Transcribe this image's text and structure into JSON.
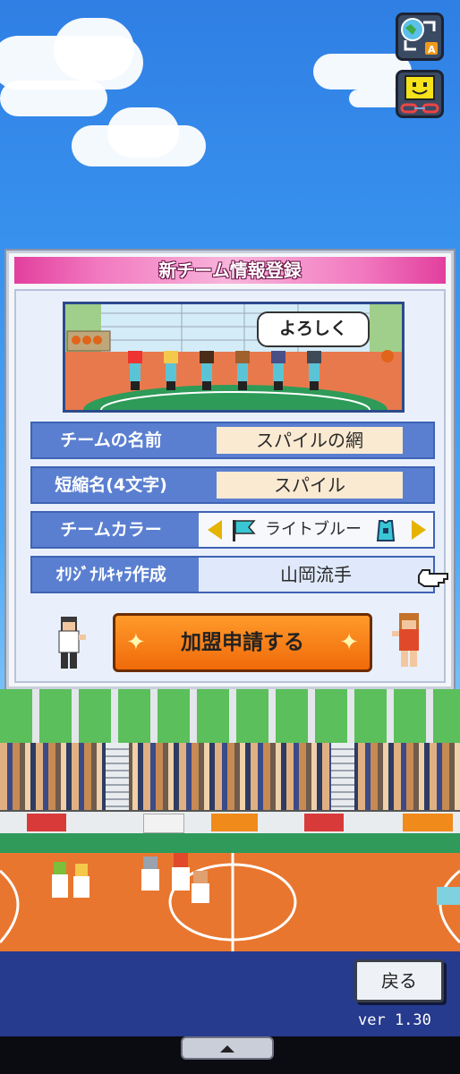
{
  "dialog": {
    "title": "新チーム情報登録",
    "speech": "よろしく",
    "rows": [
      {
        "label": "チームの名前",
        "value": "スパイルの網"
      },
      {
        "label": "短縮名(4文字)",
        "value": "スパイル"
      },
      {
        "label": "チームカラー",
        "value": "ライトブルー"
      },
      {
        "label": "ｵﾘｼﾞﾅﾙｷｬﾗ作成",
        "value": "山岡流手"
      }
    ],
    "join_button": "加盟申請する"
  },
  "footer": {
    "back_button": "戻る",
    "version": "ver 1.30"
  },
  "colors": {
    "title_pink": "#e23f9e",
    "row_blue": "#5b7fd0",
    "button_orange": "#f06a0a",
    "team_color": "#39c7d6"
  }
}
